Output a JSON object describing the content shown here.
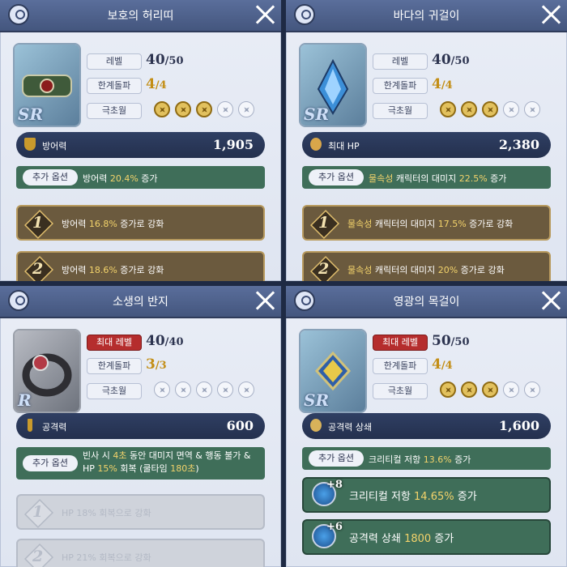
{
  "panels": [
    {
      "title": "보호의 허리띠",
      "rank": "SR",
      "level_label": "레벨",
      "level": "40",
      "level_max": "/50",
      "limit_label": "한계돌파",
      "limit": "4",
      "limit_max": "/4",
      "ultra_label": "극초월",
      "ultra_stars": [
        1,
        1,
        1,
        0,
        0
      ],
      "stat_name": "방어력",
      "stat_value": "1,905",
      "option_tag": "추가 옵션",
      "option_prefix": "방어력 ",
      "option_hl": "20.4%",
      "option_suffix": " 증가",
      "bars": [
        {
          "num": "1",
          "prefix": "방어력 ",
          "hl": "16.8%",
          "suffix": " 증가로 강화"
        },
        {
          "num": "2",
          "prefix": "방어력 ",
          "hl": "18.6%",
          "suffix": " 증가로 강화"
        }
      ],
      "colors": {
        "bar": "#6b5a3e"
      }
    },
    {
      "title": "바다의 귀걸이",
      "rank": "SR",
      "level_label": "레벨",
      "level": "40",
      "level_max": "/50",
      "limit_label": "한계돌파",
      "limit": "4",
      "limit_max": "/4",
      "ultra_label": "극초월",
      "ultra_stars": [
        1,
        1,
        1,
        0,
        0
      ],
      "stat_name": "최대 HP",
      "stat_value": "2,380",
      "option_tag": "추가 옵션",
      "option_hl1": "물속성",
      "option_mid": " 캐릭터의 대미지 ",
      "option_hl": "22.5%",
      "option_suffix": " 증가",
      "bars": [
        {
          "num": "1",
          "hl1": "물속성",
          "mid": " 캐릭터의 대미지 ",
          "hl": "17.5%",
          "suffix": " 증가로 강화"
        },
        {
          "num": "2",
          "hl1": "물속성",
          "mid": " 캐릭터의 대미지 ",
          "hl": "20%",
          "suffix": " 증가로 강화"
        }
      ]
    },
    {
      "title": "소생의 반지",
      "rank": "R",
      "level_label": "최대 레벨",
      "level": "40",
      "level_max": "/40",
      "limit_label": "한계돌파",
      "limit": "3",
      "limit_max": "/3",
      "ultra_label": "극초월",
      "ultra_stars": [
        0,
        0,
        0,
        0,
        0
      ],
      "stat_name": "공격력",
      "stat_value": "600",
      "option_tag": "추가 옵션",
      "option_line1_a": "빈사 시 ",
      "option_line1_hl": "4초",
      "option_line1_b": " 동안 대미지 면역 & 행동 불가 &",
      "option_line2_a": "HP ",
      "option_line2_hl": "15%",
      "option_line2_b": " 회복 (쿨타임 ",
      "option_line2_hl2": "180초",
      "option_line2_c": ")",
      "bars": [
        {
          "num": "1",
          "prefix": "HP ",
          "hl": "18%",
          "suffix": " 회복으로 강화"
        },
        {
          "num": "2",
          "prefix": "HP ",
          "hl": "21%",
          "suffix": " 회복으로 강화"
        }
      ]
    },
    {
      "title": "영광의 목걸이",
      "rank": "SR",
      "level_label": "최대 레벨",
      "level": "50",
      "level_max": "/50",
      "limit_label": "한계돌파",
      "limit": "4",
      "limit_max": "/4",
      "ultra_label": "극초월",
      "ultra_stars": [
        1,
        1,
        1,
        0,
        0
      ],
      "stat_name": "공격력 상쇄",
      "stat_value": "1,600",
      "option_tag": "추가 옵션",
      "option_prefix": "크리티컬 저항 ",
      "option_hl": "13.6%",
      "option_suffix": " 증가",
      "bars": [
        {
          "plus": "+8",
          "prefix": "크리티컬 저항 ",
          "hl": "14.65%",
          "suffix": " 증가"
        },
        {
          "plus": "+6",
          "prefix": "공격력 상쇄 ",
          "hl": "1800",
          "suffix": " 증가"
        }
      ]
    }
  ]
}
